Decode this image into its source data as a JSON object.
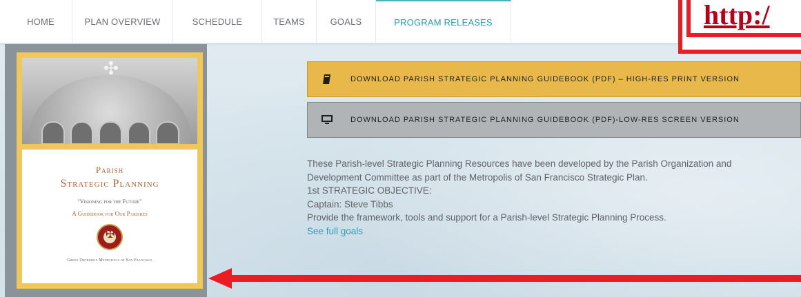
{
  "nav": {
    "items": [
      {
        "label": "HOME"
      },
      {
        "label": "PLAN OVERVIEW"
      },
      {
        "label": "SCHEDULE"
      },
      {
        "label": "TEAMS"
      },
      {
        "label": "GOALS"
      },
      {
        "label": "PROGRAM RELEASES",
        "active": true
      }
    ]
  },
  "annotation": {
    "url_text": "http:/"
  },
  "cover": {
    "line1": "Parish",
    "line2": "Strategic Planning",
    "line3": "\"Visioning for the Future\"",
    "line4": "A Guidebook for Our Parishes",
    "line5": "Greek Orthodox Metropolis of San Francisco"
  },
  "downloads": [
    {
      "label": "DOWNLOAD PARISH STRATEGIC PLANNING GUIDEBOOK (PDF) – HIGH-RES PRINT VERSION",
      "icon": "book-icon"
    },
    {
      "label": "DOWNLOAD PARISH STRATEGIC PLANNING GUIDEBOOK (PDF)-LOW-RES SCREEN VERSION",
      "icon": "monitor-icon"
    }
  ],
  "description": {
    "line1": "These Parish-level Strategic Planning Resources have been developed by the Parish Organization and",
    "line2": "Development Committee as part of the Metropolis of San Francisco Strategic Plan.",
    "line3": "1st STRATEGIC OBJECTIVE:",
    "line4": "Captain: Steve Tibbs",
    "line5": "Provide the framework, tools and support for a Parish-level Strategic Planning Process.",
    "link": "See full goals"
  },
  "colors": {
    "accent": "#2a9aa8",
    "gold_button": "#e8b94a",
    "gray_button": "#b1b4b6",
    "annotation_red": "#ea1c24"
  }
}
